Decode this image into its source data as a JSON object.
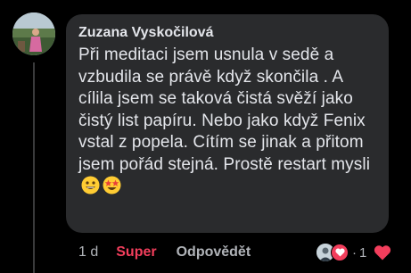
{
  "comment": {
    "author": "Zuzana Vyskočilová",
    "text": "Při meditaci jsem usnula v sedě a vzbudila se právě když skončila . A cílila jsem se taková čistá svěží jako čistý list papíru. Nebo jako když Fenix vstal z popela. Cítím se jinak a přitom jsem pořád stejná. Prostě restart mysli",
    "emojis": [
      "grinning-face-emoji",
      "star-struck-emoji"
    ]
  },
  "actions": {
    "time": "1 d",
    "super_label": "Super",
    "reply_label": "Odpovědět"
  },
  "reactions": {
    "dot": "·",
    "count": "1",
    "heart_color": "#f23e5c"
  },
  "colors": {
    "bubble": "#2a2b2d",
    "text": "#e4e6eb",
    "muted": "#b0b3b8",
    "accent": "#f23e5c"
  }
}
